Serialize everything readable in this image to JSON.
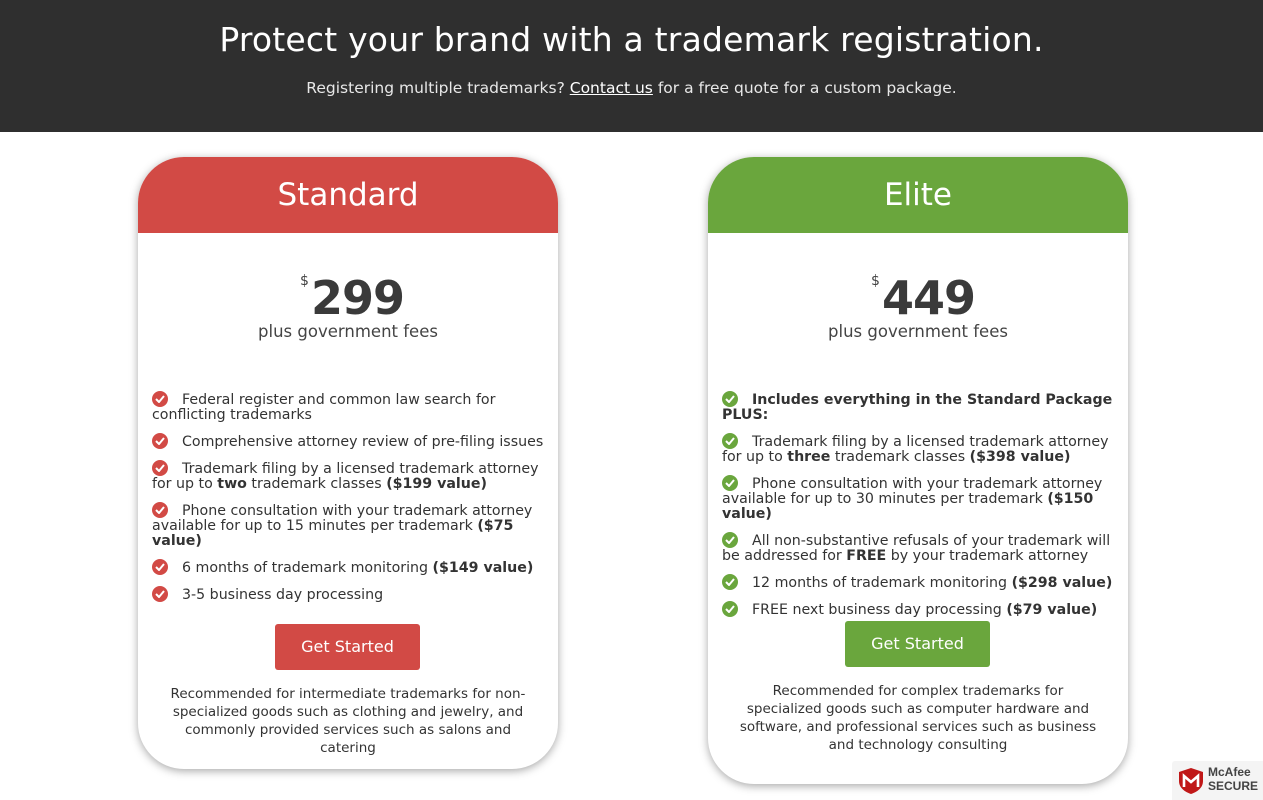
{
  "hero": {
    "title": "Protect your brand with a trademark registration.",
    "sub_before": "Registering multiple trademarks?",
    "sub_link": "Contact us",
    "sub_after": "for a free quote for a custom package."
  },
  "standard": {
    "name": "Standard",
    "currency": "$",
    "price": "299",
    "fees": "plus government fees",
    "features": [
      {
        "pre": "Federal register and common law search for conflicting trademarks",
        "b1": "",
        "mid": "",
        "b2": ""
      },
      {
        "pre": "Comprehensive attorney review of pre-filing issues",
        "b1": "",
        "mid": "",
        "b2": ""
      },
      {
        "pre": "Trademark filing by a licensed trademark attorney for up to ",
        "b1": "two",
        "mid": " trademark classes ",
        "b2": "($199 value)"
      },
      {
        "pre": "Phone consultation with your trademark attorney available for up to 15 minutes per trademark ",
        "b1": "($75 value)",
        "mid": "",
        "b2": ""
      },
      {
        "pre": "6 months of trademark monitoring ",
        "b1": "($149 value)",
        "mid": "",
        "b2": ""
      },
      {
        "pre": "3-5 business day processing",
        "b1": "",
        "mid": "",
        "b2": ""
      }
    ],
    "button": "Get Started",
    "recommendation": "Recommended for intermediate trademarks for non-specialized goods such as clothing and jewelry, and commonly provided services such as salons and catering"
  },
  "elite": {
    "name": "Elite",
    "currency": "$",
    "price": "449",
    "fees": "plus government fees",
    "features": [
      {
        "pre": "",
        "b1": "Includes everything in the Standard Package PLUS:",
        "mid": "",
        "b2": ""
      },
      {
        "pre": "Trademark filing by a licensed trademark attorney for up to ",
        "b1": "three",
        "mid": " trademark classes ",
        "b2": "($398 value)"
      },
      {
        "pre": "Phone consultation with your trademark attorney available for up to 30 minutes per trademark ",
        "b1": "($150 value)",
        "mid": "",
        "b2": ""
      },
      {
        "pre": "All non-substantive refusals of your trademark will be addressed for ",
        "b1": "FREE",
        "mid": " by your trademark attorney",
        "b2": ""
      },
      {
        "pre": "12 months of trademark monitoring ",
        "b1": "($298 value)",
        "mid": "",
        "b2": ""
      },
      {
        "pre": "FREE next business day processing ",
        "b1": "($79 value)",
        "mid": "",
        "b2": ""
      }
    ],
    "button": "Get Started",
    "recommendation": "Recommended for complex trademarks for specialized goods such as computer hardware and software, and professional services such as business and technology consulting"
  },
  "badge": {
    "line1": "McAfee",
    "line2": "SECURE"
  },
  "colors": {
    "standard": "#d24a45",
    "elite": "#6aa63d",
    "hero_bg": "#2f2f2f"
  }
}
